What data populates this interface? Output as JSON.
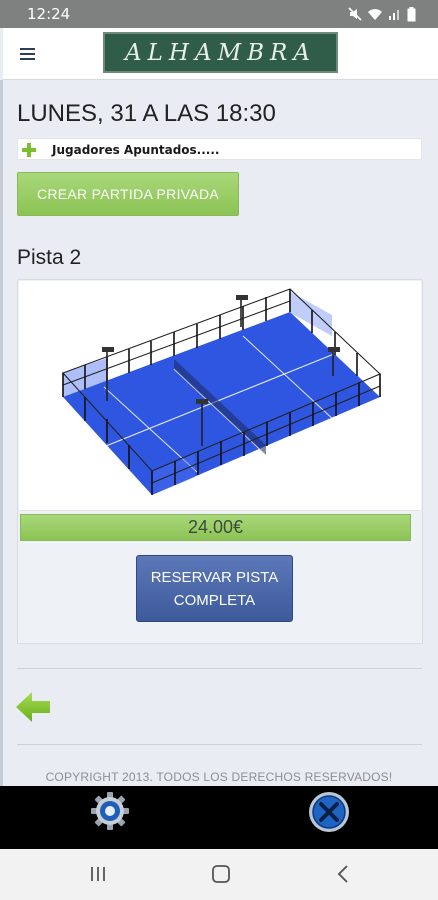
{
  "status_bar": {
    "time": "12:24",
    "icons": [
      "mute-icon",
      "wifi-icon",
      "signal-icon",
      "battery-icon"
    ]
  },
  "header": {
    "logo_text": "ALHAMBRA",
    "menu_icon": "hamburger-menu-icon"
  },
  "booking": {
    "date_title": "LUNES, 31 A LAS 18:30",
    "players_label": "Jugadores Apuntados.....",
    "create_button": "CREAR PARTIDA PRIVADA"
  },
  "court": {
    "title": "Pista 2",
    "price": "24.00€",
    "reserve_button_line1": "RESERVAR PISTA",
    "reserve_button_line2": "COMPLETA"
  },
  "footer": {
    "back_icon": "arrow-left-icon",
    "copyright": "COPYRIGHT 2013. TODOS LOS DERECHOS RESERVADOS!"
  },
  "app_bar": {
    "left_icon": "settings-gear-icon",
    "right_icon": "close-icon"
  },
  "nav_bar": {
    "icons": [
      "recent-apps-icon",
      "home-icon",
      "back-icon"
    ]
  },
  "colors": {
    "accent_green": "#8cc354",
    "button_blue": "#3d5a9a",
    "court_blue": "#2f56e0",
    "background": "#e9edf3"
  }
}
